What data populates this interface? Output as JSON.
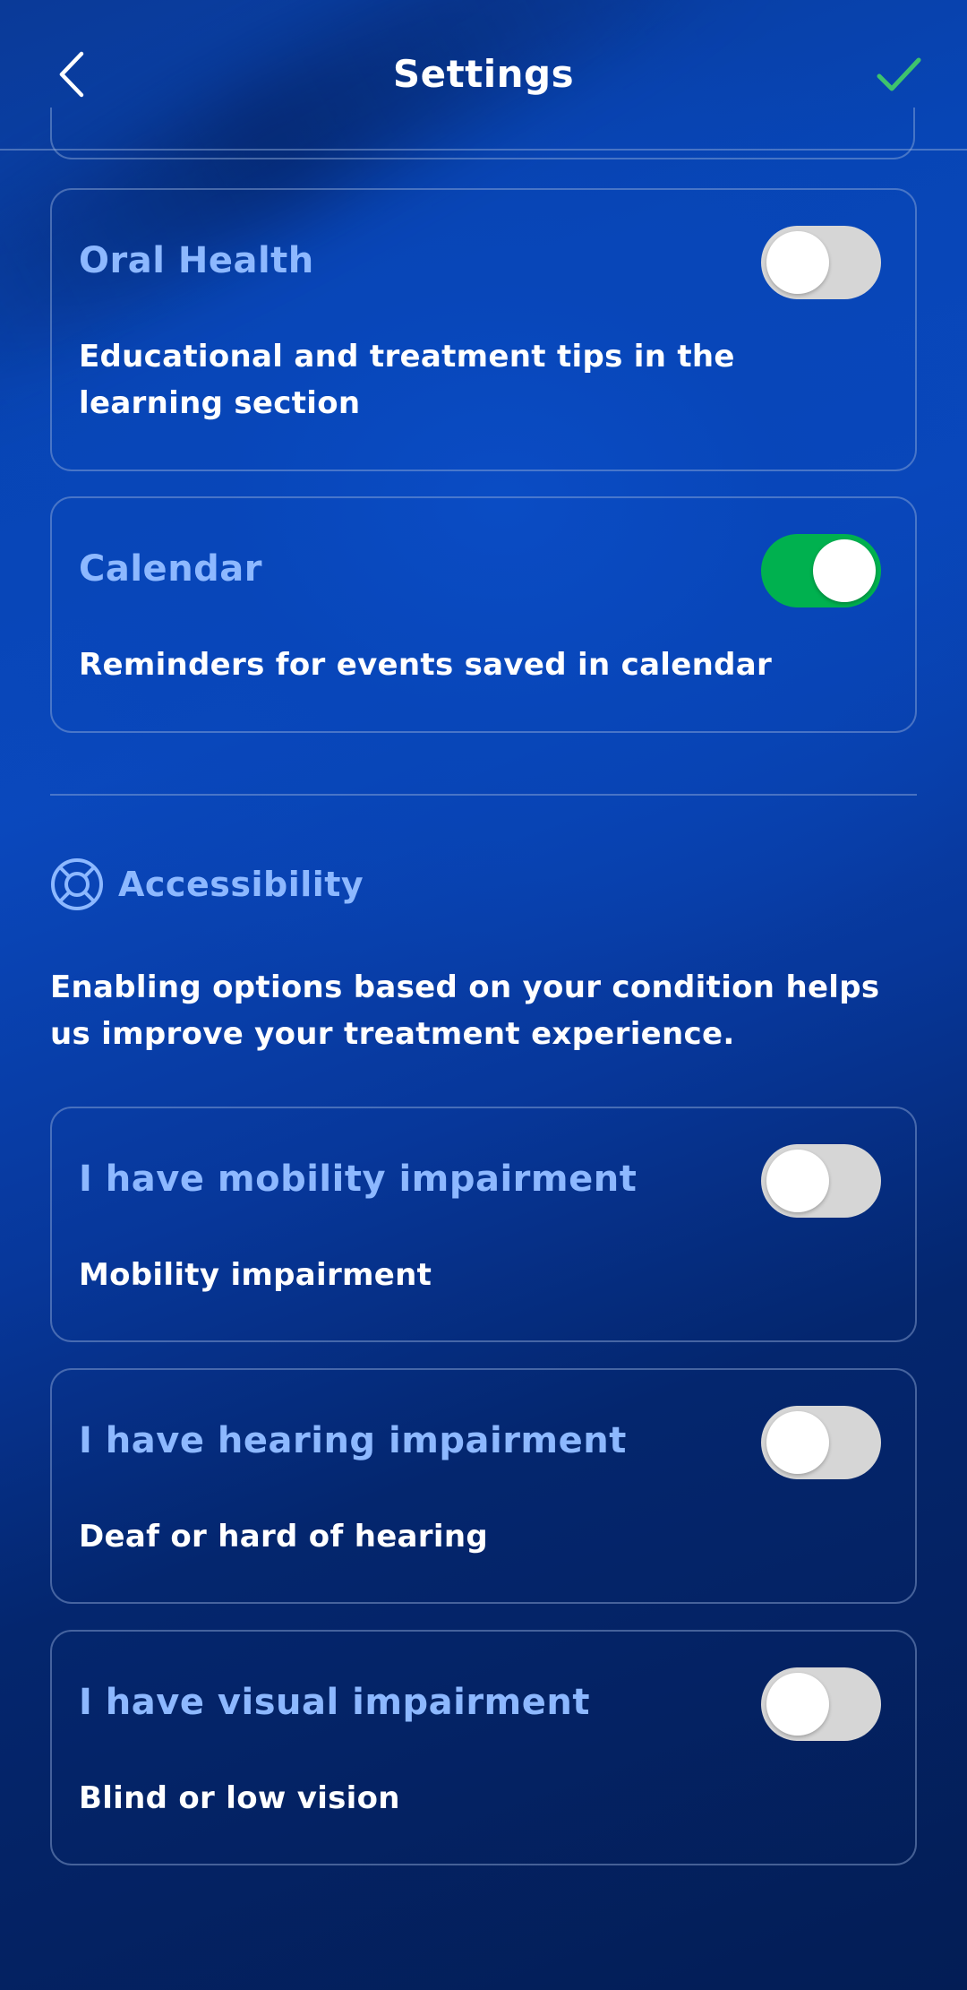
{
  "header": {
    "title": "Settings",
    "back_icon": "chevron-left-icon",
    "confirm_icon": "checkmark-icon"
  },
  "notifications": [
    {
      "title": "Oral Health",
      "description": "Educational and treatment tips in the learning section",
      "enabled": false
    },
    {
      "title": "Calendar",
      "description": "Reminders for events saved in calendar",
      "enabled": true
    }
  ],
  "accessibility": {
    "title": "Accessibility",
    "icon": "lifebuoy-icon",
    "description": "Enabling options based on your condition helps us improve your treatment experience.",
    "options": [
      {
        "title": "I have mobility impairment",
        "description": "Mobility impairment",
        "enabled": false
      },
      {
        "title": "I have hearing impairment",
        "description": "Deaf or hard of hearing",
        "enabled": false
      },
      {
        "title": "I have visual impairment",
        "description": "Blind or low vision",
        "enabled": false
      }
    ]
  },
  "colors": {
    "accent_text": "#8db8ff",
    "toggle_on": "#00b14f",
    "toggle_off": "#d6d6d6",
    "confirm_check": "#3ec46d",
    "background_top": "#0745b5",
    "background_bottom": "#031d55"
  }
}
